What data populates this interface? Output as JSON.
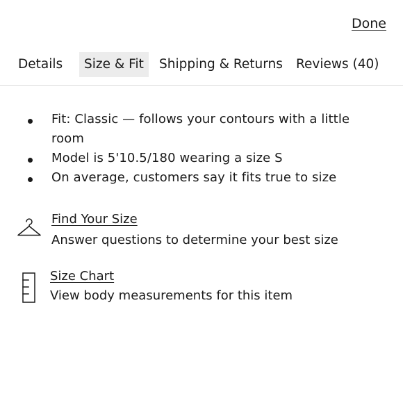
{
  "header": {
    "done_label": "Done"
  },
  "tabs": [
    {
      "label": "Details",
      "active": false
    },
    {
      "label": "Size & Fit",
      "active": true
    },
    {
      "label": "Shipping & Returns",
      "active": false
    },
    {
      "label": "Reviews (40)",
      "active": false
    }
  ],
  "fit_notes": [
    "Fit: Classic — follows your contours with a little room",
    "Model is 5'10.5/180 wearing a size S",
    "On average, customers say it fits true to size"
  ],
  "tools": {
    "find_size": {
      "icon": "hanger-icon",
      "title": "Find Your Size",
      "description": "Answer questions to determine your best size"
    },
    "size_chart": {
      "icon": "ruler-icon",
      "title": "Size Chart",
      "description": "View body measurements for this item"
    }
  },
  "colors": {
    "text": "#1a1a1a",
    "active_tab_bg": "#ececec",
    "divider": "#d9d9d9"
  }
}
